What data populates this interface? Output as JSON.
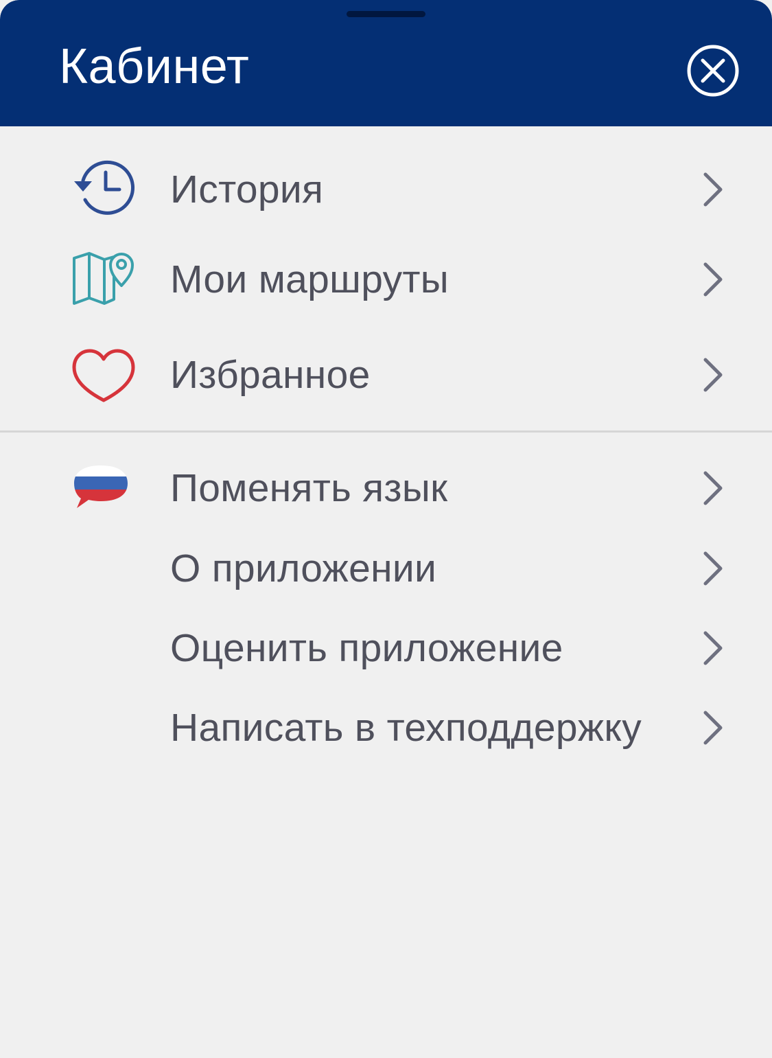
{
  "header": {
    "title": "Кабинет",
    "close_icon": "close-circle-icon",
    "background": "#042f74"
  },
  "menu": {
    "items": [
      {
        "label": "История",
        "icon": "history-icon"
      },
      {
        "label": "Мои маршруты",
        "icon": "map-pin-icon"
      },
      {
        "label": "Избранное",
        "icon": "heart-icon"
      }
    ]
  },
  "settings": {
    "items": [
      {
        "label": "Поменять язык",
        "icon": "russian-flag-bubble-icon"
      },
      {
        "label": "О приложении"
      },
      {
        "label": "Оценить приложение"
      },
      {
        "label": "Написать в техподдержку"
      }
    ]
  },
  "colors": {
    "accent_blue": "#2e4d94",
    "teal": "#3aa0ab",
    "red": "#d6343b",
    "text": "#4f505c",
    "chevron": "#6e7080"
  }
}
